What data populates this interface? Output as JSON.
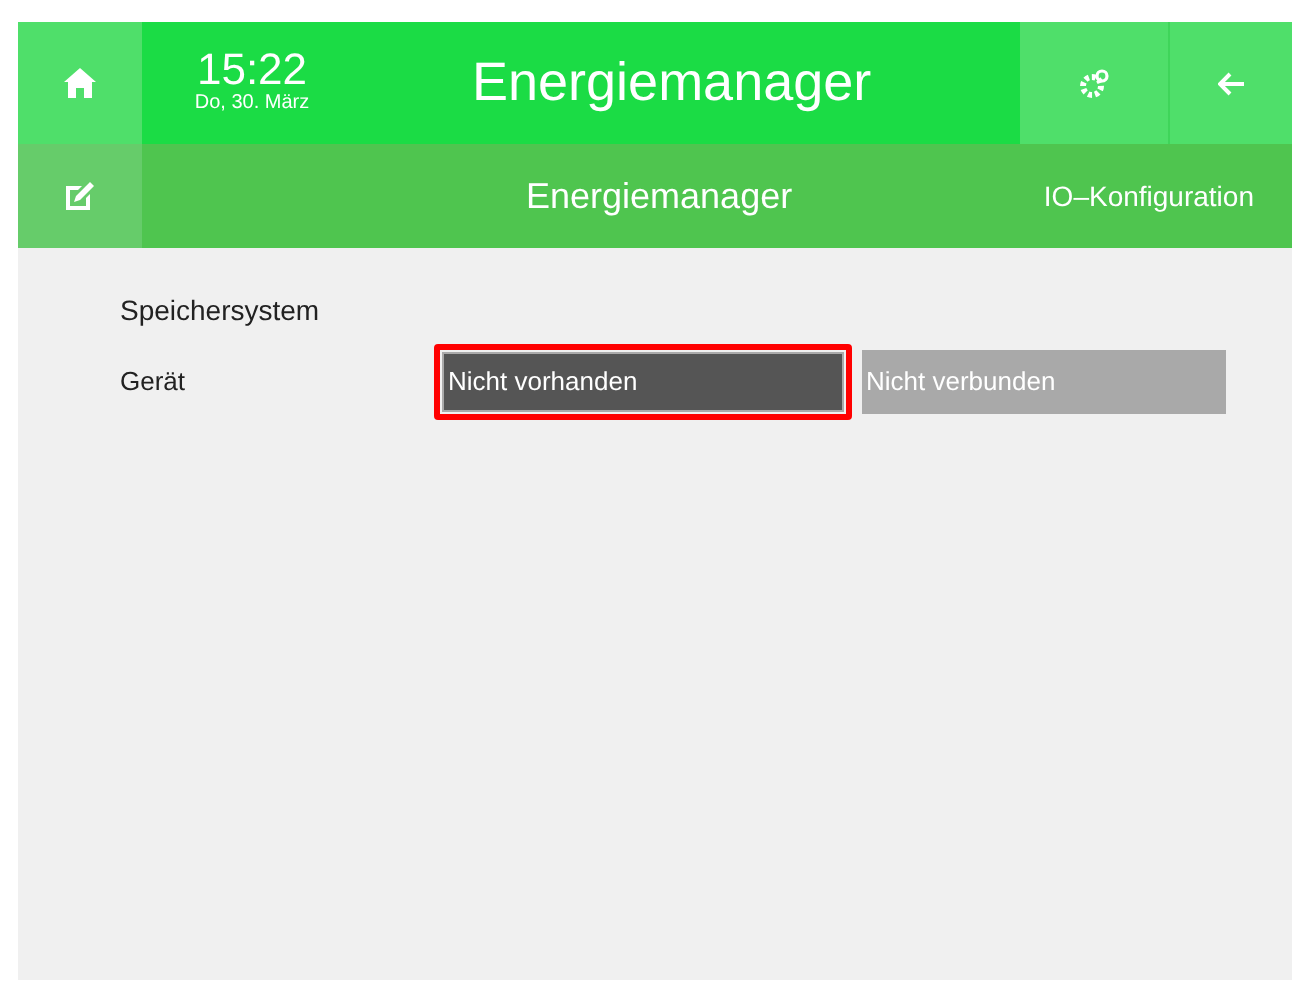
{
  "header": {
    "time": "15:22",
    "date": "Do, 30. März",
    "title": "Energiemanager"
  },
  "subheader": {
    "title": "Energiemanager",
    "link": "IO–Konfiguration"
  },
  "section": {
    "title": "Speichersystem"
  },
  "rows": [
    {
      "label": "Gerät",
      "value": "Nicht vorhanden",
      "highlighted": true,
      "status": "Nicht verbunden",
      "disabled": true
    }
  ]
}
